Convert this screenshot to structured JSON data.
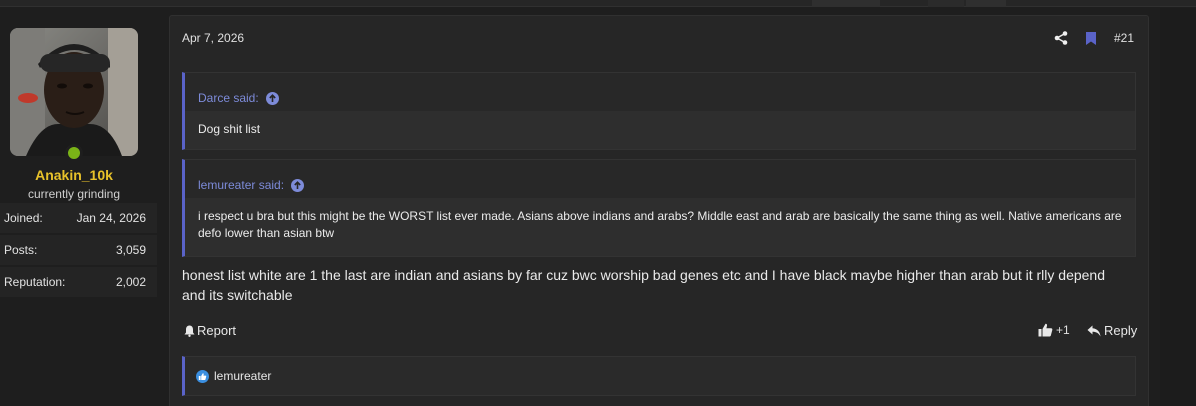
{
  "user": {
    "username": "Anakin_10k",
    "title": "currently grinding",
    "status_color": "#7ab317",
    "name_color": "#e8c22a",
    "stats": [
      {
        "label": "Joined:",
        "value": "Jan 24, 2026"
      },
      {
        "label": "Posts:",
        "value": "3,059"
      },
      {
        "label": "Reputation:",
        "value": "2,002"
      }
    ]
  },
  "post": {
    "date": "Apr 7, 2026",
    "number": "#21",
    "icons": {
      "share": "share-icon",
      "bookmark": "bookmark-icon"
    },
    "quotes": [
      {
        "author": "Darce said:",
        "text": "Dog shit list"
      },
      {
        "author": "lemureater said:",
        "text": "i respect u bra but this might be the WORST list ever made. Asians above indians and arabs? Middle east and arab are basically the same thing as well. Native americans are defo lower than asian btw"
      }
    ],
    "body": "honest list white are 1 the last are indian and asians by far cuz bwc worship bad genes etc and I have black maybe higher than arab but it rlly depend and its switchable",
    "actions": {
      "report_label": "Report",
      "like_count": "+1",
      "reply_label": "Reply"
    },
    "reactions": {
      "users": "lemureater",
      "icon": "like-reaction-icon"
    }
  },
  "colors": {
    "accent": "#5a63c8",
    "link": "#7d8bd9",
    "background": "#1e1e1e",
    "panel": "#262626"
  }
}
